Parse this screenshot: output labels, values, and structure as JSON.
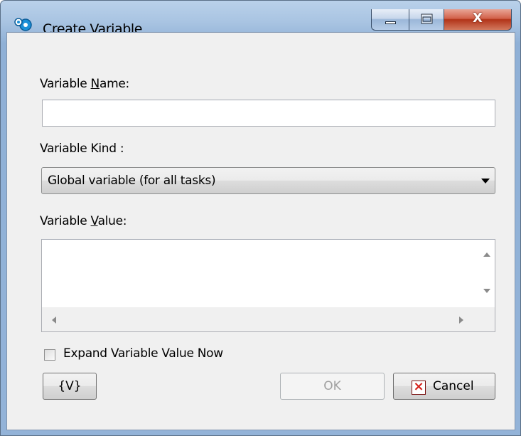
{
  "window": {
    "title": "Create Variable",
    "close_glyph": "X"
  },
  "form": {
    "name_label_pre": "Variable ",
    "name_label_mnemonic": "N",
    "name_label_post": "ame:",
    "name_value": "",
    "kind_label": "Variable Kind :",
    "kind_selected": "Global variable (for all tasks)",
    "value_label_pre": "Variable ",
    "value_label_mnemonic": "V",
    "value_label_post": "alue:",
    "value_text": "",
    "expand_label": "Expand Variable Value Now",
    "expand_checked": false
  },
  "buttons": {
    "variables_label": "{V}",
    "ok_label": "OK",
    "cancel_label": "Cancel"
  },
  "colors": {
    "close_red": "#c4422a",
    "cancel_icon_red": "#d6201a"
  },
  "icons": [
    "app-icon",
    "minimize-icon",
    "maximize-icon",
    "close-icon",
    "cancel-x-icon"
  ]
}
